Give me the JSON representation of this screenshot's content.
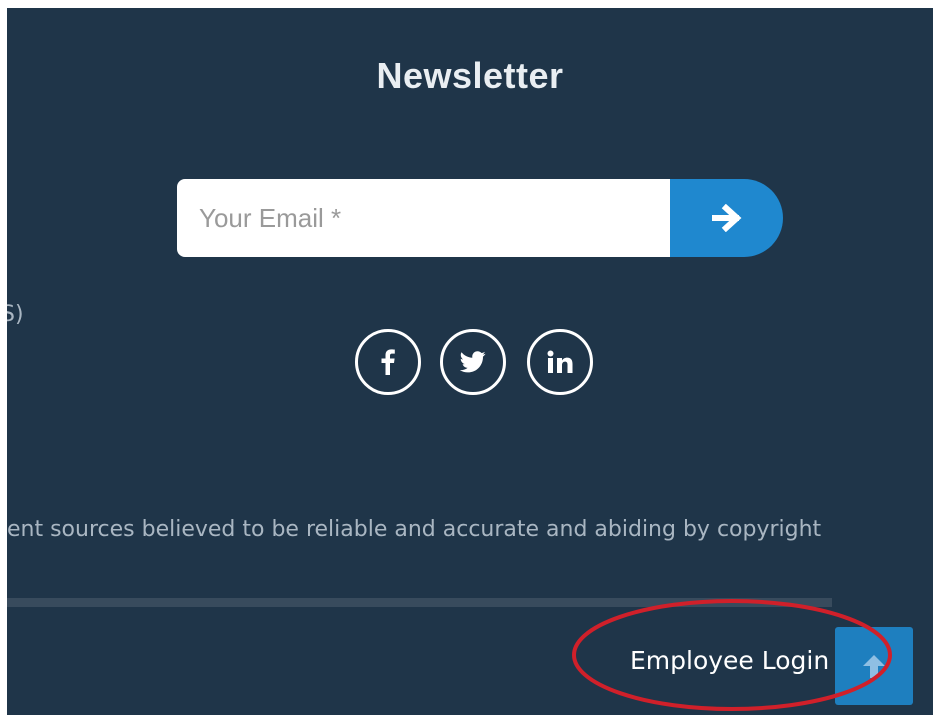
{
  "newsletter": {
    "title": "Newsletter",
    "email_placeholder": "Your Email *",
    "submit_icon": "arrow-right-icon"
  },
  "social": [
    {
      "name": "facebook",
      "icon": "facebook-icon"
    },
    {
      "name": "twitter",
      "icon": "twitter-icon"
    },
    {
      "name": "linkedin",
      "icon": "linkedin-icon"
    }
  ],
  "footer": {
    "cut_left_text": "S)",
    "cut_sentence": "ent sources believed to be reliable and accurate and abiding by copyright",
    "employee_login": "Employee Login",
    "back_to_top_icon": "arrow-up-icon"
  },
  "colors": {
    "background": "#1f3549",
    "accent": "#1f88cf",
    "annotation": "#d0202a"
  }
}
